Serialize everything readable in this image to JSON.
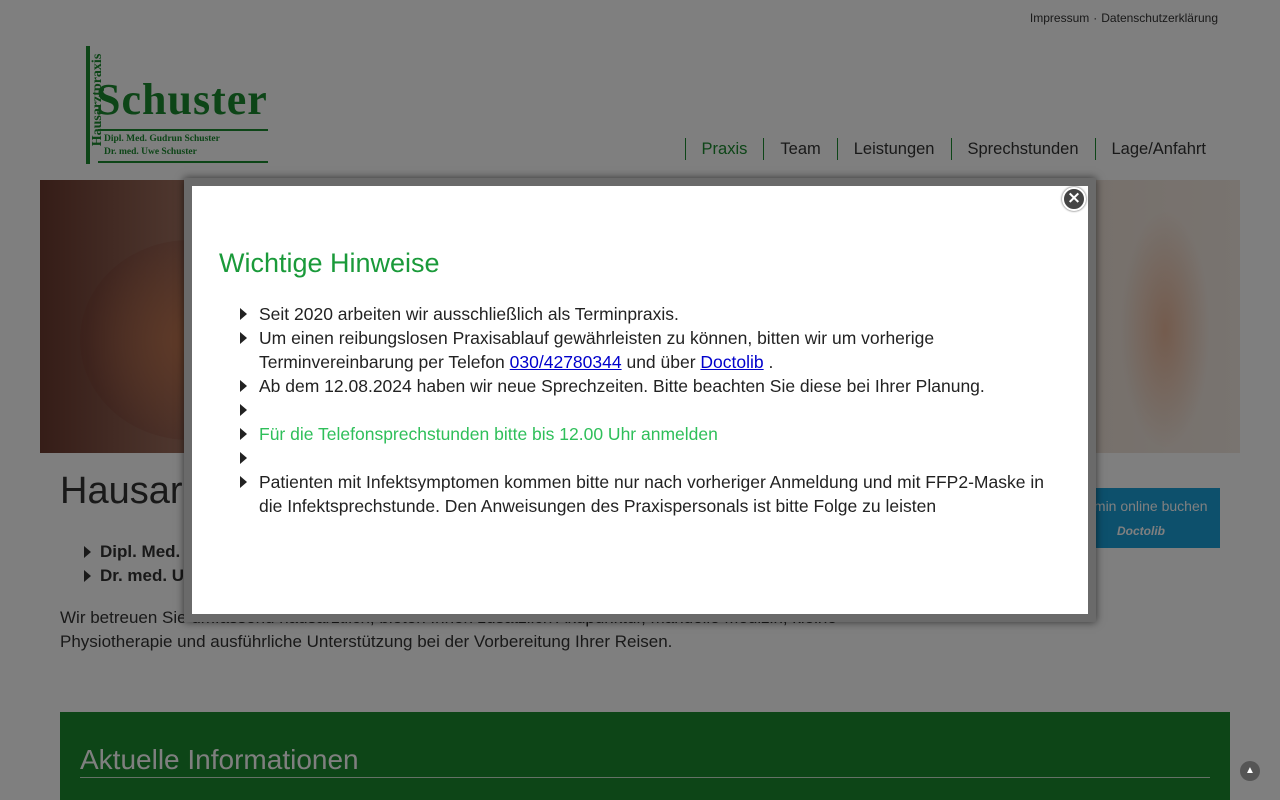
{
  "header": {
    "toplinks": [
      "Impressum",
      "Datenschutzerklärung"
    ],
    "separator": "·"
  },
  "logo": {
    "vertical_text": "Hausarztpraxis",
    "name": "Schuster",
    "line1": "Dipl. Med. Gudrun Schuster",
    "line2": "Dr. med. Uwe Schuster"
  },
  "nav": {
    "items": [
      {
        "label": "Praxis",
        "active": true
      },
      {
        "label": "Team"
      },
      {
        "label": "Leistungen"
      },
      {
        "label": "Sprechstunden"
      },
      {
        "label": "Lage/Anfahrt"
      }
    ]
  },
  "main": {
    "title": "Hausarztpraxis Schuster",
    "doctors": [
      "Dipl. Med. Gudrun Schuster",
      "Dr. med. Uwe Schuster"
    ],
    "intro": "Wir betreuen Sie umfassend hausärztlich, bieten Ihnen zusätzlich Akupunktur, manuelle Medizin, kleine Physiotherapie und ausführliche Unterstützung bei der Vorbereitung Ihrer Reisen.",
    "doctolib_button": {
      "line1": "Termin online buchen",
      "line2": "Doctolib"
    },
    "news_title": "Aktuelle Informationen"
  },
  "modal": {
    "title": "Wichtige Hinweise",
    "close_icon": "close-icon",
    "items": {
      "i0": "Seit 2020 arbeiten wir ausschließlich als Terminpraxis.",
      "i1_pre": "Um einen reibungslosen Praxisablauf gewährleisten zu können, bitten wir um vorherige Terminvereinbarung per Telefon ",
      "i1_phone": "030/42780344",
      "i1_mid": " und über ",
      "i1_link": "Doctolib",
      "i1_post": " .",
      "i2": "Ab dem 12.08.2024 haben wir neue Sprechzeiten. Bitte beachten Sie diese bei Ihrer Planung.",
      "i4": "Für die Telefonsprechstunden bitte bis 12.00 Uhr anmelden",
      "i6": "Patienten mit Infektsymptomen kommen bitte nur nach vorheriger Anmeldung und mit FFP2-Maske in die Infektsprechstunde. Den Anweisungen des Praxispersonals ist bitte Folge zu leisten"
    }
  },
  "colors": {
    "brand_green": "#1a8a2e",
    "modal_title": "#1a9a3a",
    "highlight_green": "#2fbf5a",
    "link_blue": "#0000cc",
    "doctolib_blue": "#1ba1d9"
  },
  "icons": {
    "scroll_top": "scroll-to-top-icon"
  }
}
